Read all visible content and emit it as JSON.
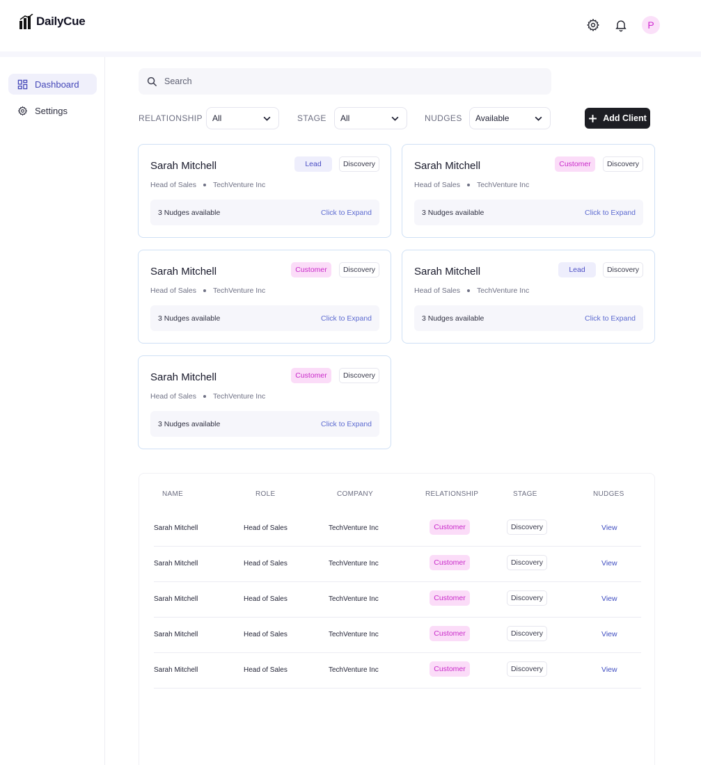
{
  "app": {
    "name": "DailyCue"
  },
  "header": {
    "avatar_initial": "P"
  },
  "sidebar": {
    "items": [
      {
        "label": "Dashboard",
        "active": true
      },
      {
        "label": "Settings",
        "active": false
      }
    ]
  },
  "search": {
    "placeholder": "Search",
    "value": ""
  },
  "filters": {
    "relationship": {
      "label": "RELATIONSHIP",
      "value": "All"
    },
    "stage": {
      "label": "STAGE",
      "value": "All"
    },
    "nudges": {
      "label": "NUDGES",
      "value": "Available"
    }
  },
  "add_client_label": "Add Client",
  "cards": [
    {
      "name": "Sarah Mitchell",
      "relationship": "Lead",
      "stage": "Discovery",
      "role": "Head of Sales",
      "company": "TechVenture Inc",
      "nudges": "3 Nudges available",
      "expand": "Click to Expand"
    },
    {
      "name": "Sarah Mitchell",
      "relationship": "Customer",
      "stage": "Discovery",
      "role": "Head of Sales",
      "company": "TechVenture Inc",
      "nudges": "3 Nudges available",
      "expand": "Click to Expand"
    },
    {
      "name": "Sarah Mitchell",
      "relationship": "Customer",
      "stage": "Discovery",
      "role": "Head of Sales",
      "company": "TechVenture Inc",
      "nudges": "3 Nudges available",
      "expand": "Click to Expand"
    },
    {
      "name": "Sarah Mitchell",
      "relationship": "Lead",
      "stage": "Discovery",
      "role": "Head of Sales",
      "company": "TechVenture Inc",
      "nudges": "3 Nudges available",
      "expand": "Click to Expand"
    },
    {
      "name": "Sarah Mitchell",
      "relationship": "Customer",
      "stage": "Discovery",
      "role": "Head of Sales",
      "company": "TechVenture Inc",
      "nudges": "3 Nudges available",
      "expand": "Click to Expand"
    }
  ],
  "table": {
    "headers": [
      "NAME",
      "ROLE",
      "COMPANY",
      "RELATIONSHIP",
      "STAGE",
      "NUDGES"
    ],
    "rows": [
      {
        "name": "Sarah Mitchell",
        "role": "Head of Sales",
        "company": "TechVenture Inc",
        "relationship": "Customer",
        "stage": "Discovery",
        "action": "View"
      },
      {
        "name": "Sarah Mitchell",
        "role": "Head of Sales",
        "company": "TechVenture Inc",
        "relationship": "Customer",
        "stage": "Discovery",
        "action": "View"
      },
      {
        "name": "Sarah Mitchell",
        "role": "Head of Sales",
        "company": "TechVenture Inc",
        "relationship": "Customer",
        "stage": "Discovery",
        "action": "View"
      },
      {
        "name": "Sarah Mitchell",
        "role": "Head of Sales",
        "company": "TechVenture Inc",
        "relationship": "Customer",
        "stage": "Discovery",
        "action": "View"
      },
      {
        "name": "Sarah Mitchell",
        "role": "Head of Sales",
        "company": "TechVenture Inc",
        "relationship": "Customer",
        "stage": "Discovery",
        "action": "View"
      }
    ]
  },
  "colors": {
    "accent": "#4447b8",
    "customer_badge_bg": "#fbdcf8",
    "customer_badge_text": "#c92ac9",
    "lead_badge_bg": "#eeeefc",
    "lead_badge_text": "#4a4dc4",
    "primary_button": "#1d1e24"
  }
}
